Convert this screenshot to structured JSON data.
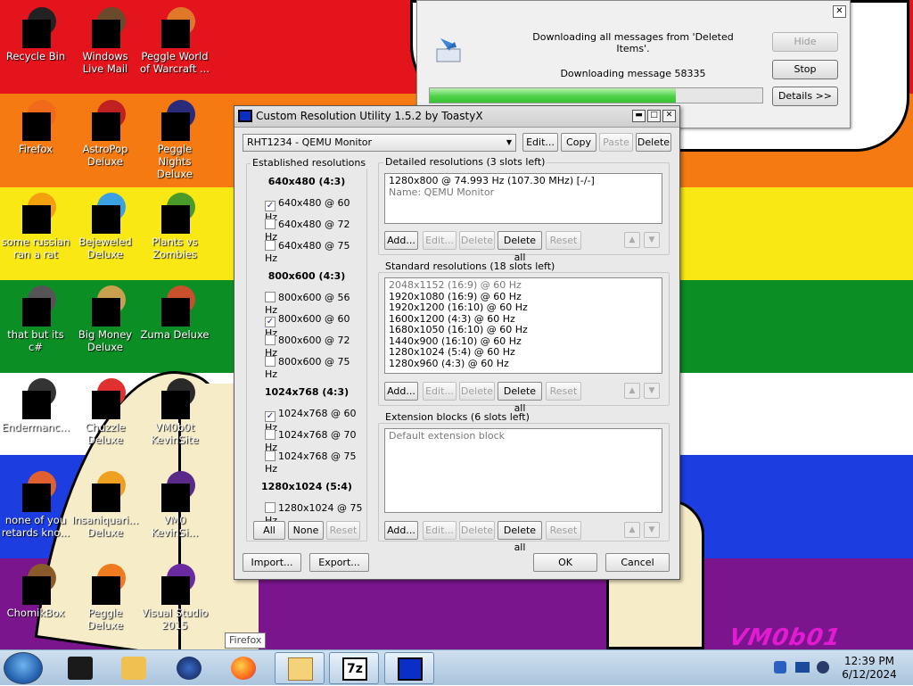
{
  "desktop": {
    "icons": [
      {
        "label": "Recycle Bin",
        "icon": "recycle-bin-icon"
      },
      {
        "label": "Windows Live Mail",
        "icon": "mail-icon"
      },
      {
        "label": "Peggle World of Warcraft ...",
        "icon": "peggle-icon"
      },
      {
        "label": "Firefox",
        "icon": "firefox-icon"
      },
      {
        "label": "AstroPop Deluxe",
        "icon": "astropop-icon"
      },
      {
        "label": "Peggle Nights Deluxe",
        "icon": "peggle-nights-icon"
      },
      {
        "label": "some russian ran a rat",
        "icon": "app-icon"
      },
      {
        "label": "Bejeweled Deluxe",
        "icon": "bejeweled-icon"
      },
      {
        "label": "Plants vs Zombies",
        "icon": "pvz-icon"
      },
      {
        "label": "that but its c#",
        "icon": "app-icon"
      },
      {
        "label": "Big Money Deluxe",
        "icon": "big-money-icon"
      },
      {
        "label": "Zuma Deluxe",
        "icon": "zuma-icon"
      },
      {
        "label": "Endermanc...",
        "icon": "app-icon"
      },
      {
        "label": "Chuzzle Deluxe",
        "icon": "chuzzle-icon"
      },
      {
        "label": "VM0b0t KevinSite",
        "icon": "shortcut-icon"
      },
      {
        "label": "none of you retards kno...",
        "icon": "app-icon"
      },
      {
        "label": "Insaniquari... Deluxe",
        "icon": "insaniquarium-icon"
      },
      {
        "label": "VM0 KevinSi...",
        "icon": "shortcut-icon"
      },
      {
        "label": "ChomikBox",
        "icon": "chomikbox-icon"
      },
      {
        "label": "Peggle Deluxe",
        "icon": "peggle-icon"
      },
      {
        "label": "Visual Studio 2015",
        "icon": "visual-studio-icon"
      }
    ],
    "signature": "VM0b01"
  },
  "download_dialog": {
    "line1": "Downloading all messages from 'Deleted Items'.",
    "line2": "Downloading message 58335",
    "progress": 0.74,
    "hide_label": "Hide",
    "stop_label": "Stop",
    "details_label": "Details >>"
  },
  "cru": {
    "title": "Custom Resolution Utility 1.5.2 by ToastyX",
    "monitor": "RHT1234 - QEMU Monitor",
    "top_buttons": {
      "edit": "Edit...",
      "copy": "Copy",
      "paste": "Paste",
      "delete": "Delete"
    },
    "established": {
      "title": "Established resolutions",
      "groups": [
        {
          "header": "640x480 (4:3)",
          "items": [
            {
              "label": "640x480 @ 60 Hz",
              "checked": true
            },
            {
              "label": "640x480 @ 72 Hz",
              "checked": false
            },
            {
              "label": "640x480 @ 75 Hz",
              "checked": false
            }
          ]
        },
        {
          "header": "800x600 (4:3)",
          "items": [
            {
              "label": "800x600 @ 56 Hz",
              "checked": false
            },
            {
              "label": "800x600 @ 60 Hz",
              "checked": true
            },
            {
              "label": "800x600 @ 72 Hz",
              "checked": false
            },
            {
              "label": "800x600 @ 75 Hz",
              "checked": false
            }
          ]
        },
        {
          "header": "1024x768 (4:3)",
          "items": [
            {
              "label": "1024x768 @ 60 Hz",
              "checked": true
            },
            {
              "label": "1024x768 @ 70 Hz",
              "checked": false
            },
            {
              "label": "1024x768 @ 75 Hz",
              "checked": false
            }
          ]
        },
        {
          "header": "1280x1024 (5:4)",
          "items": [
            {
              "label": "1280x1024 @ 75 Hz",
              "checked": false
            }
          ]
        }
      ],
      "all": "All",
      "none": "None",
      "reset": "Reset"
    },
    "detailed": {
      "title": "Detailed resolutions (3 slots left)",
      "lines": [
        "1280x800 @ 74.993 Hz (107.30 MHz) [-/-]",
        "Name: QEMU Monitor"
      ]
    },
    "standard": {
      "title": "Standard resolutions (18 slots left)",
      "lines": [
        "2048x1152 (16:9) @ 60 Hz",
        "1920x1080 (16:9) @ 60 Hz",
        "1920x1200 (16:10) @ 60 Hz",
        "1600x1200 (4:3) @ 60 Hz",
        "1680x1050 (16:10) @ 60 Hz",
        "1440x900 (16:10) @ 60 Hz",
        "1280x1024 (5:4) @ 60 Hz",
        "1280x960 (4:3) @ 60 Hz"
      ]
    },
    "extension": {
      "title": "Extension blocks (6 slots left)",
      "lines": [
        "Default extension block"
      ]
    },
    "list_buttons": {
      "add": "Add...",
      "edit": "Edit...",
      "delete": "Delete",
      "delete_all": "Delete all",
      "reset": "Reset"
    },
    "import": "Import...",
    "export": "Export...",
    "ok": "OK",
    "cancel": "Cancel"
  },
  "taskbar": {
    "tooltip": "Firefox",
    "time": "12:39 PM",
    "date": "6/12/2024"
  }
}
